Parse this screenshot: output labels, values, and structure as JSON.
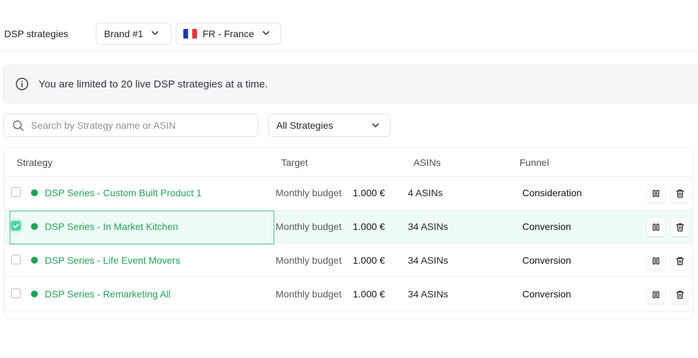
{
  "header": {
    "title": "DSP strategies",
    "brand_select": "Brand #1",
    "country_select": "FR - France",
    "country_flag": [
      "#1f3aa6",
      "#ffffff",
      "#e8343c"
    ]
  },
  "banner": {
    "icon": "info-icon",
    "text": "You are limited to 20 live DSP strategies at a time."
  },
  "filters": {
    "search_placeholder": "Search by Strategy name or ASIN",
    "strategy_filter": "All Strategies"
  },
  "table": {
    "columns": [
      "Strategy",
      "Target",
      "ASINs",
      "Funnel"
    ],
    "rows": [
      {
        "checked": false,
        "status": "active",
        "name": "DSP Series - Custom Built Product 1",
        "target_label": "Monthly budget",
        "target_value": "1.000 €",
        "asins": "4 ASINs",
        "funnel": "Consideration"
      },
      {
        "checked": true,
        "status": "active",
        "name": "DSP Series - In Market Kitchen",
        "target_label": "Monthly budget",
        "target_value": "1.000 €",
        "asins": "34 ASINs",
        "funnel": "Conversion"
      },
      {
        "checked": false,
        "status": "active",
        "name": "DSP Series - Life Event Movers",
        "target_label": "Monthly budget",
        "target_value": "1.000 €",
        "asins": "34 ASINs",
        "funnel": "Conversion"
      },
      {
        "checked": false,
        "status": "active",
        "name": "DSP Series - Remarketing All",
        "target_label": "Monthly budget",
        "target_value": "1.000 €",
        "asins": "34 ASINs",
        "funnel": "Conversion"
      }
    ],
    "row_actions": [
      "pause-icon",
      "trash-icon"
    ]
  },
  "colors": {
    "accent_green": "#22a257",
    "selected_row_bg": "#effbf6",
    "checkbox_checked": "#4fd1a1"
  }
}
